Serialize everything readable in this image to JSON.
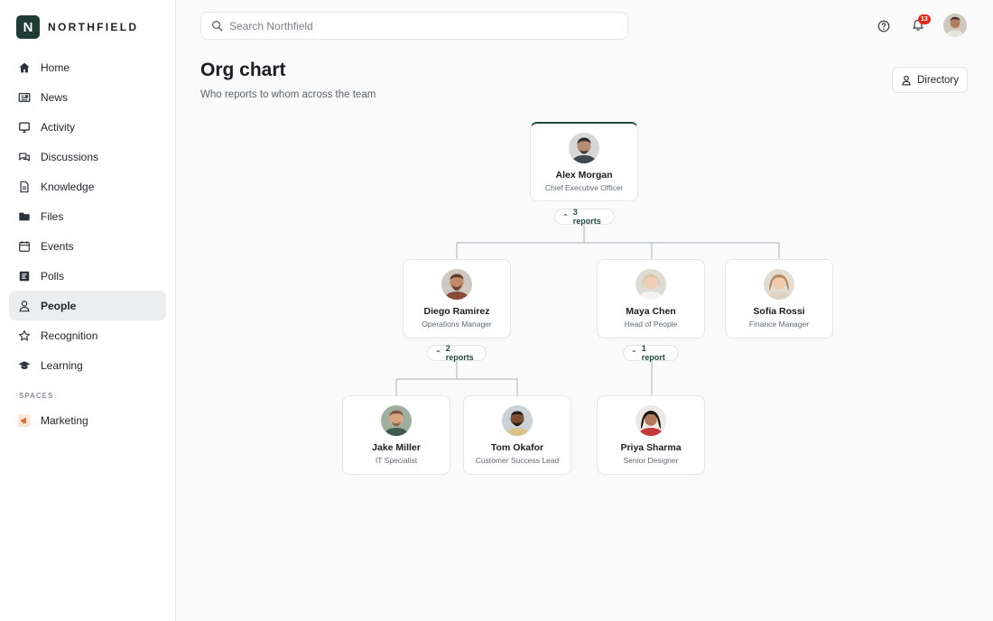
{
  "brand": {
    "logo_letter": "N",
    "name": "NORTHFIELD",
    "color": "#1e3b34"
  },
  "nav": [
    {
      "label": "Home",
      "icon": "home-icon"
    },
    {
      "label": "News",
      "icon": "newspaper-icon"
    },
    {
      "label": "Activity",
      "icon": "monitor-icon"
    },
    {
      "label": "Discussions",
      "icon": "chat-bubbles-icon"
    },
    {
      "label": "Knowledge",
      "icon": "document-icon"
    },
    {
      "label": "Files",
      "icon": "folder-icon"
    },
    {
      "label": "Events",
      "icon": "calendar-icon"
    },
    {
      "label": "Polls",
      "icon": "poll-icon"
    },
    {
      "label": "People",
      "icon": "person-icon",
      "active": true
    },
    {
      "label": "Recognition",
      "icon": "star-icon"
    },
    {
      "label": "Learning",
      "icon": "graduation-cap-icon"
    }
  ],
  "spaces": {
    "label": "SPACES",
    "items": [
      {
        "label": "Marketing",
        "icon": "megaphone-icon"
      }
    ]
  },
  "search": {
    "placeholder": "Search Northfield"
  },
  "topbar": {
    "notification_count": "13"
  },
  "header": {
    "title": "Org chart",
    "subtitle": "Who reports to whom across the team",
    "directory_label": "Directory"
  },
  "org": {
    "root": {
      "name": "Alex Morgan",
      "role": "Chief Executive Officer",
      "reports_label": "3 reports"
    },
    "diego": {
      "name": "Diego Ramirez",
      "role": "Operations Manager",
      "reports_label": "2 reports"
    },
    "maya": {
      "name": "Maya Chen",
      "role": "Head of People",
      "reports_label": "1 report"
    },
    "sofia": {
      "name": "Sofia Rossi",
      "role": "Finance Manager"
    },
    "jake": {
      "name": "Jake Miller",
      "role": "IT Specialist"
    },
    "tom": {
      "name": "Tom Okafor",
      "role": "Customer Success Lead"
    },
    "priya": {
      "name": "Priya Sharma",
      "role": "Senior Designer"
    }
  },
  "colors": {
    "accent": "#1e4a3f",
    "badge": "#d92d20",
    "connector": "#b8bdc3"
  }
}
